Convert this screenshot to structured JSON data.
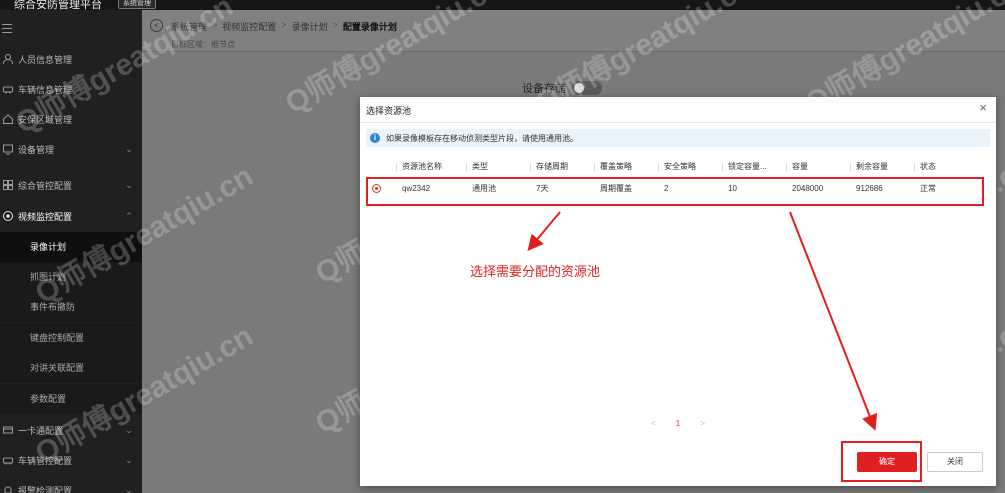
{
  "topbar": {
    "app_title": "综合安防管理平台",
    "system_button": "系统管理"
  },
  "sidebar": {
    "items": [
      {
        "label": "人员信息管理",
        "icon": "person-icon",
        "chevron": ""
      },
      {
        "label": "车辆信息管理",
        "icon": "car-icon",
        "chevron": ""
      },
      {
        "label": "安保区域管理",
        "icon": "home-icon",
        "chevron": ""
      },
      {
        "label": "设备管理",
        "icon": "device-icon",
        "chevron": "⌄"
      },
      {
        "label": "综合管控配置",
        "icon": "grid-icon",
        "chevron": "⌄"
      },
      {
        "label": "视频监控配置",
        "icon": "video-icon",
        "chevron": "⌃"
      }
    ],
    "sub_items": [
      "录像计划",
      "抓图计划",
      "事件布撤防",
      "键盘控制配置",
      "对讲关联配置",
      "参数配置"
    ],
    "bottom_items": [
      {
        "label": "一卡通配置",
        "icon": "card-icon",
        "chevron": "⌄"
      },
      {
        "label": "车辆管控配置",
        "icon": "car-icon",
        "chevron": "⌄"
      },
      {
        "label": "报警检测配置",
        "icon": "alarm-icon",
        "chevron": "⌄"
      }
    ]
  },
  "breadcrumb": {
    "items": [
      "系统管理",
      "视频监控配置",
      "录像计划"
    ],
    "current": "配置录像计划",
    "separator": ">"
  },
  "area_label": "目标区域：根节点",
  "storage": {
    "label": "设备存储"
  },
  "dialog": {
    "title": "选择资源池",
    "close_symbol": "×",
    "info": "如果录像模板存在移动侦测类型片段，请使用通用池。",
    "columns": [
      "资源池名称",
      "类型",
      "存储周期",
      "覆盖策略",
      "安全策略",
      "锁定容量...",
      "容量",
      "剩余容量",
      "状态"
    ],
    "rows": [
      [
        "qw2342",
        "通用池",
        "7天",
        "周期覆盖",
        "2",
        "10",
        "2048000",
        "912686",
        "正常"
      ]
    ],
    "pagination": {
      "prev": "<",
      "page": "1",
      "next": ">"
    },
    "ok_label": "确定",
    "close_label": "关闭"
  },
  "annotation": "选择需要分配的资源池",
  "watermark": "Q师傅greatqiu.cn",
  "colors": {
    "accent": "#e02020",
    "sidebar_bg": "#202020",
    "info_bg": "#e8f3fc"
  }
}
